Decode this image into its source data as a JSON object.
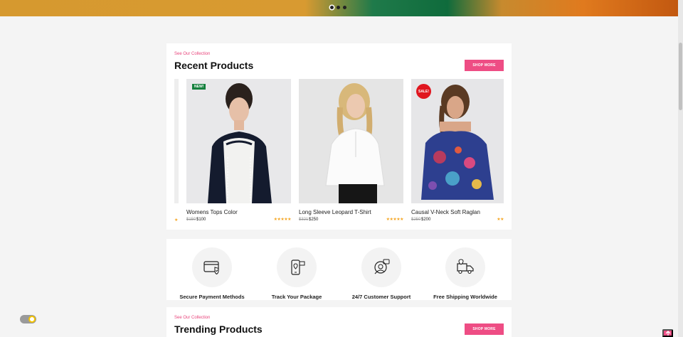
{
  "hero": {
    "slide_count": 3,
    "active_slide": 1
  },
  "recent": {
    "eyebrow": "See Our Collection",
    "title": "Recent Products",
    "shop_more": "SHOP MORE",
    "partial_stars": "★",
    "products": [
      {
        "name": "Womens Tops Color",
        "old_price": "$150",
        "price": "$100",
        "stars": "★★★★★",
        "badge": "NEW!"
      },
      {
        "name": "Long Sleeve Leopard T-Shirt",
        "old_price": "$321",
        "price": "$250",
        "stars": "★★★★★",
        "badge": ""
      },
      {
        "name": "Causal V-Neck Soft Raglan",
        "old_price": "$250",
        "price": "$200",
        "stars": "★★",
        "badge": "SALE!"
      }
    ]
  },
  "features": [
    {
      "label": "Secure Payment Methods",
      "icon": "credit-card-shield-icon"
    },
    {
      "label": "Track Your Package",
      "icon": "phone-tracking-icon"
    },
    {
      "label": "24/7 Customer Support",
      "icon": "customer-support-icon"
    },
    {
      "label": "Free Shipping Worldwide",
      "icon": "delivery-truck-icon"
    }
  ],
  "trending": {
    "eyebrow": "See Our Collection",
    "title": "Trending Products",
    "shop_more": "SHOP MORE"
  }
}
